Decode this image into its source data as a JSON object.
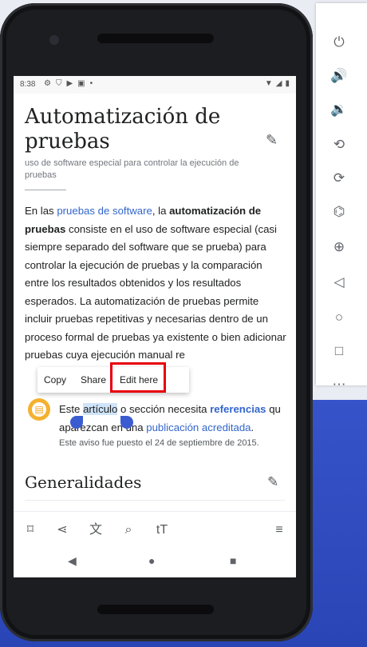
{
  "status_bar": {
    "time": "8:38"
  },
  "article": {
    "title": "Automatización de pruebas",
    "subtitle": "uso de software especial para controlar la ejecución de pruebas",
    "p1_a": "En las ",
    "p1_link": "pruebas de software",
    "p1_b": ", la ",
    "p1_bold": "automatización de pruebas",
    "p1_c": " consiste en el uso de software especial (casi siempre separado del software que se prueba) para controlar la ejecución de pruebas y la comparación entre los resultados obtenidos y los resultados esperados. La automatización de pruebas permite incluir pruebas repetitivas y necesarias dentro de un proceso formal de pruebas ya existente o bien adicionar pruebas cuya ejecución manual re"
  },
  "context_menu": {
    "copy": "Copy",
    "share": "Share",
    "edit_here": "Edit here"
  },
  "notice": {
    "t1": "Este ",
    "selected": "artículo",
    "t2": " o sección necesita ",
    "link1": "referencias",
    "t3": "qu",
    "t4": " aparezcan",
    "t5": " en una ",
    "link2": "publicación acreditada",
    "t6": ".",
    "date": "Este aviso fue puesto el 24 de septiembre de 2015."
  },
  "section": {
    "heading": "Generalidades"
  },
  "icons": {
    "status": [
      "settings-icon",
      "shield-icon",
      "play-protect-icon",
      "image-icon",
      "dot-icon"
    ],
    "status_right": [
      "wifi-icon",
      "signal-icon",
      "battery-icon"
    ],
    "toolbar": [
      "bookmark-icon",
      "share-icon",
      "translate-icon",
      "find-in-page-icon",
      "text-size-icon",
      "table-of-contents-icon"
    ],
    "navbar": [
      "back-icon",
      "home-icon",
      "recents-icon"
    ],
    "sidebar": [
      "power-icon",
      "volume-up-icon",
      "volume-down-icon",
      "rotate-left-icon",
      "rotate-right-icon",
      "camera-icon",
      "zoom-icon",
      "back-icon",
      "home-icon",
      "overview-icon",
      "more-icon"
    ]
  }
}
